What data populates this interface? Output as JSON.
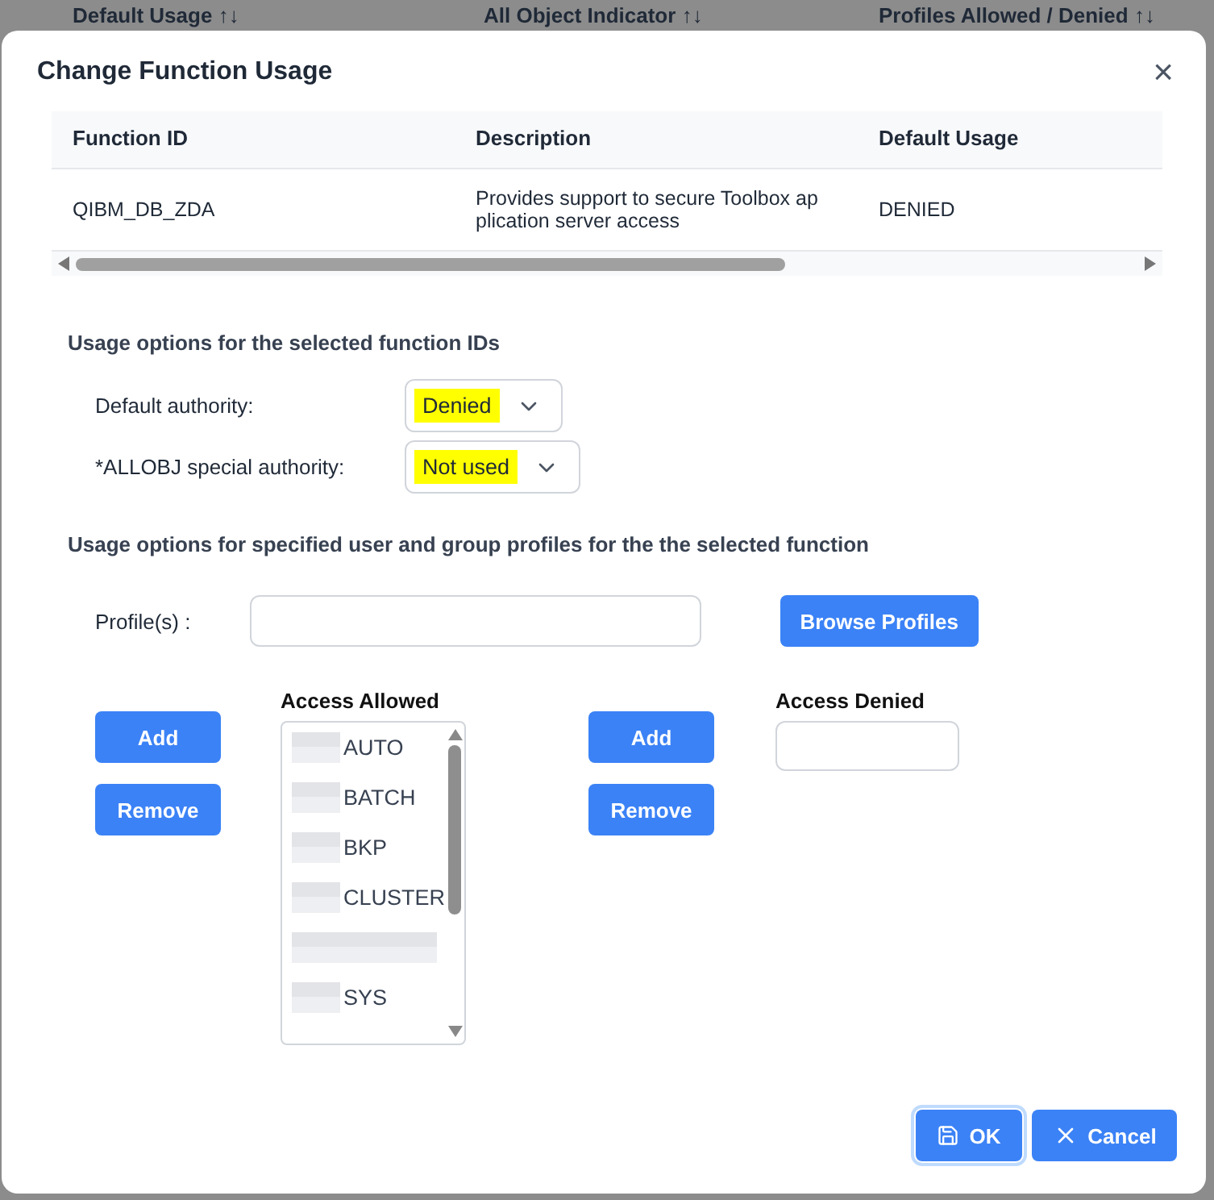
{
  "background_table": {
    "columns": [
      {
        "label": "Default Usage",
        "sort_icon": "↑↓"
      },
      {
        "label": "All Object Indicator",
        "sort_icon": "↑↓"
      },
      {
        "label": "Profiles Allowed / Denied",
        "sort_icon": "↑↓"
      }
    ]
  },
  "dialog": {
    "title": "Change Function Usage",
    "close": "×"
  },
  "table": {
    "columns": [
      "Function ID",
      "Description",
      "Default Usage"
    ],
    "rows": [
      {
        "cells": [
          "QIBM_DB_ZDA",
          "Provides support to secure Toolbox ap plication server access",
          "DENIED"
        ]
      }
    ]
  },
  "function_options": {
    "heading": "Usage options for the selected function IDs",
    "fields": [
      {
        "label": "Default authority:",
        "value": "Denied",
        "highlighted": true
      },
      {
        "label": "*ALLOBJ special authority:",
        "value": "Not used",
        "highlighted": true
      }
    ]
  },
  "profile_options": {
    "heading": "Usage options for specified user and group profiles for the the selected function",
    "profile_label": "Profile(s) :",
    "browse_button": "Browse Profiles",
    "allowed": {
      "label": "Access Allowed",
      "add": "Add",
      "remove": "Remove",
      "items": [
        {
          "name": "AUTO",
          "redacted": true
        },
        {
          "name": "BATCH",
          "redacted": true
        },
        {
          "name": "BKP",
          "redacted": true
        },
        {
          "name": "CLUSTER",
          "redacted": true
        },
        {
          "redacted": true
        },
        {
          "name": "SYS",
          "redacted": true
        }
      ]
    },
    "denied": {
      "label": "Access Denied",
      "add": "Add",
      "remove": "Remove"
    }
  },
  "footer": {
    "ok": "OK",
    "cancel": "Cancel"
  }
}
